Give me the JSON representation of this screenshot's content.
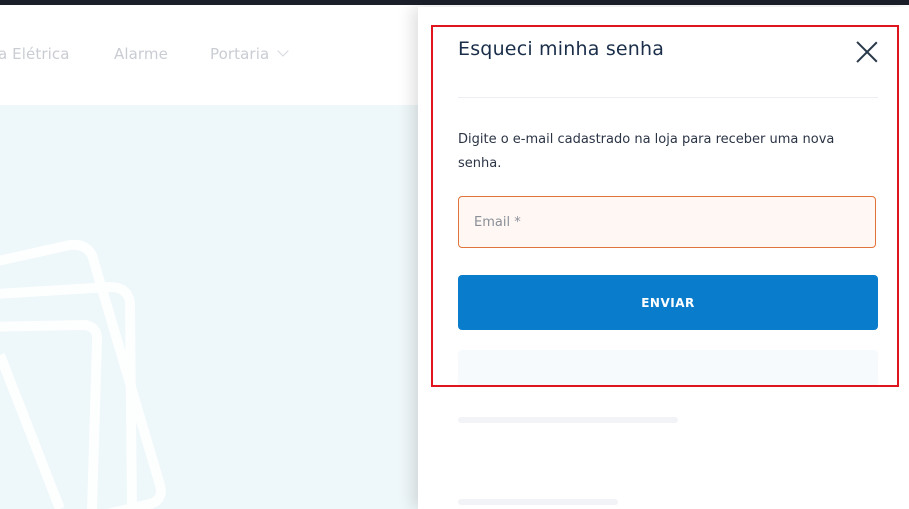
{
  "nav": {
    "items": [
      "a Elétrica",
      "Alarme",
      "Portaria"
    ]
  },
  "drawer": {
    "title": "Esqueci minha senha",
    "description": "Digite o e-mail cadastrado na loja para receber uma nova senha.",
    "email_placeholder": "Email *",
    "email_value": "",
    "submit_label": "ENVIAR"
  },
  "colors": {
    "primary_button": "#0a7ccc",
    "input_border": "#e0743a",
    "highlight": "#e0141c"
  },
  "icons": {
    "close": "close-icon",
    "portaria_dropdown": "chevron-down-icon"
  }
}
